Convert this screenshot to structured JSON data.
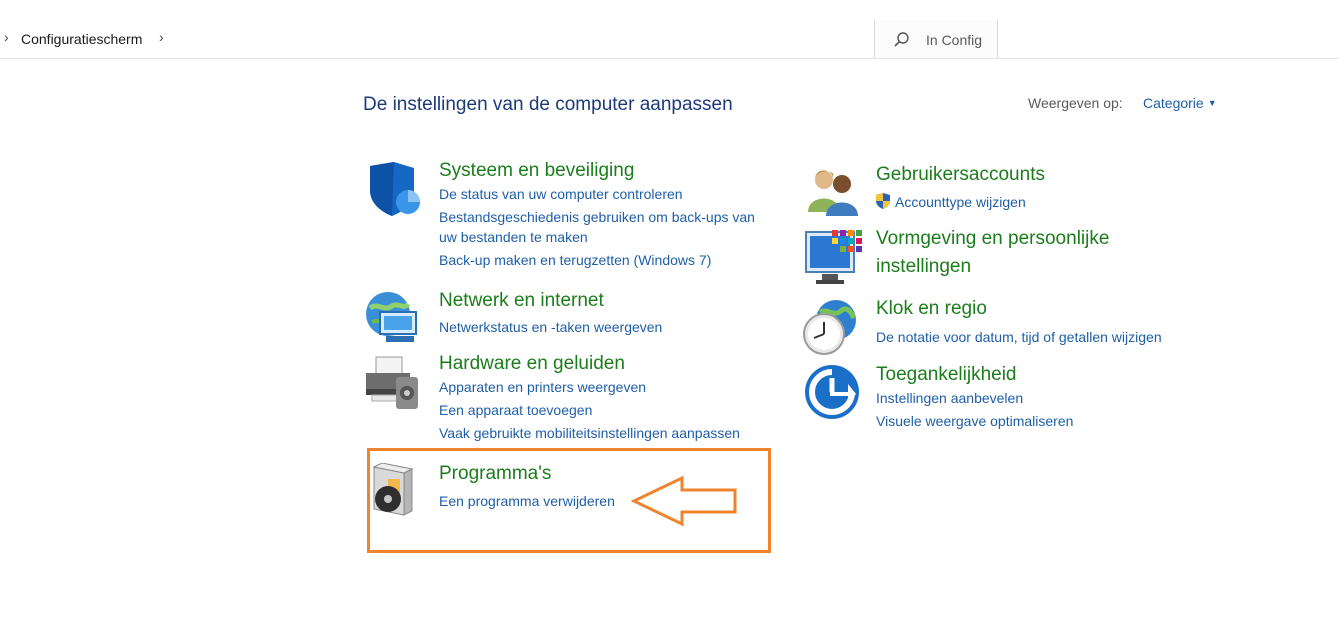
{
  "address": {
    "crumb": "Configuratiescherm",
    "search_placeholder": "In Config"
  },
  "main": {
    "heading": "De instellingen van de computer aanpassen",
    "view_by_label": "Weergeven op:",
    "view_by_value": "Categorie"
  },
  "categories": {
    "system": {
      "title": "Systeem en beveiliging",
      "links": [
        "De status van uw computer controleren",
        "Bestandsgeschiedenis gebruiken om back-ups van",
        "uw bestanden te maken",
        "Back-up maken en terugzetten (Windows 7)"
      ]
    },
    "network": {
      "title": "Netwerk en internet",
      "links": [
        "Netwerkstatus en -taken weergeven"
      ]
    },
    "hardware": {
      "title": "Hardware en geluiden",
      "links": [
        "Apparaten en printers weergeven",
        "Een apparaat toevoegen",
        "Vaak gebruikte mobiliteitsinstellingen aanpassen"
      ]
    },
    "programs": {
      "title": "Programma's",
      "links": [
        "Een programma verwijderen"
      ]
    },
    "users": {
      "title": "Gebruikersaccounts",
      "links": [
        "Accounttype wijzigen"
      ]
    },
    "appearance": {
      "title_line1": "Vormgeving en persoonlijke",
      "title_line2": "instellingen"
    },
    "clock": {
      "title": "Klok en regio",
      "links": [
        "De notatie voor datum, tijd of getallen wijzigen"
      ]
    },
    "access": {
      "title": "Toegankelijkheid",
      "links": [
        "Instellingen aanbevelen",
        "Visuele weergave optimaliseren"
      ]
    }
  },
  "colors": {
    "heading": "#1e3a7a",
    "category_title": "#1b7d1b",
    "link": "#1e5fa8",
    "highlight": "#f0832d"
  },
  "icons": [
    "chevron-right-icon",
    "search-icon",
    "shield-icon",
    "network-globe-icon",
    "printer-icon",
    "programs-disc-icon",
    "users-icon",
    "uac-shield-icon",
    "appearance-monitor-icon",
    "clock-globe-icon",
    "accessibility-icon",
    "arrow-annotation-icon"
  ]
}
